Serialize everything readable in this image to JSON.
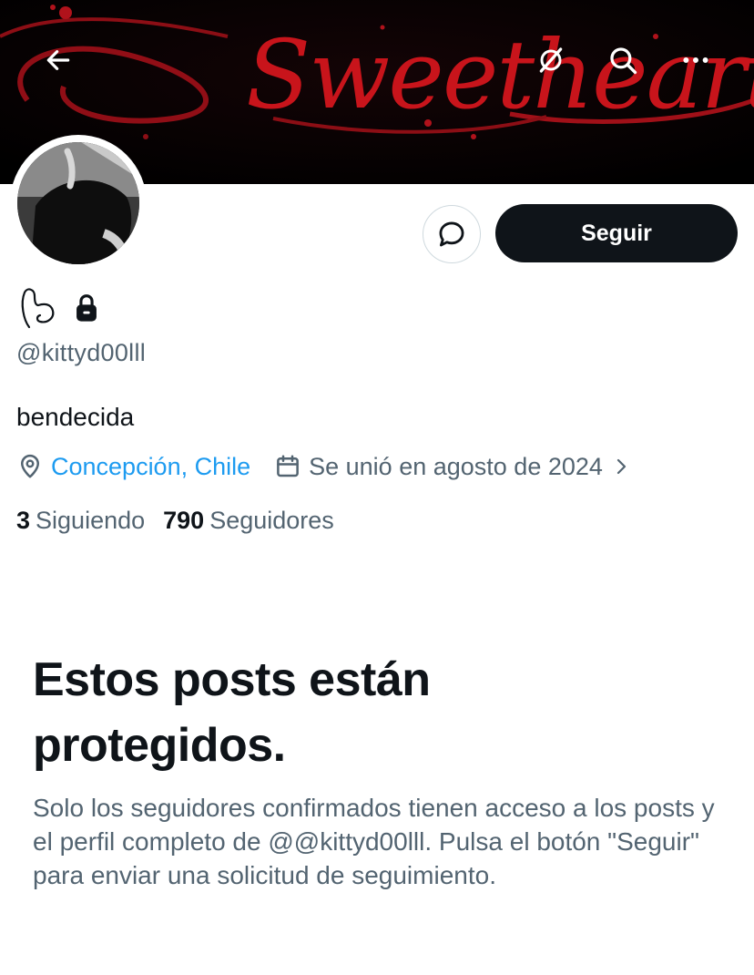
{
  "header": {
    "banner_text": "Sweetheart",
    "back_icon": "arrow-left-icon",
    "grok_icon": "grok-icon",
    "search_icon": "search-icon",
    "more_icon": "more-dots-icon",
    "banner_colors": {
      "background": "#050203",
      "text": "#c8141b"
    }
  },
  "profile": {
    "avatar_icon": "profile-photo",
    "message_icon": "message-bubble-icon",
    "follow_label": "Seguir",
    "display_name_glyph": "heart-drawing-icon",
    "protected_icon": "lock-icon",
    "handle": "@kittyd00lll",
    "bio": "bendecida",
    "location": "Concepción, Chile",
    "joined": "Se unió en agosto de 2024",
    "following_count": "3",
    "following_label": "Siguiendo",
    "followers_count": "790",
    "followers_label": "Seguidores"
  },
  "protected": {
    "title": "Estos posts están protegidos.",
    "body": "Solo los seguidores confirmados tienen acceso a los posts y el perfil completo de @@kittyd00lll. Pulsa el botón \"Seguir\" para enviar una solicitud de seguimiento."
  },
  "colors": {
    "text_primary": "#0f1419",
    "text_secondary": "#536471",
    "link": "#1d9bf0",
    "button_dark": "#0f1419"
  }
}
